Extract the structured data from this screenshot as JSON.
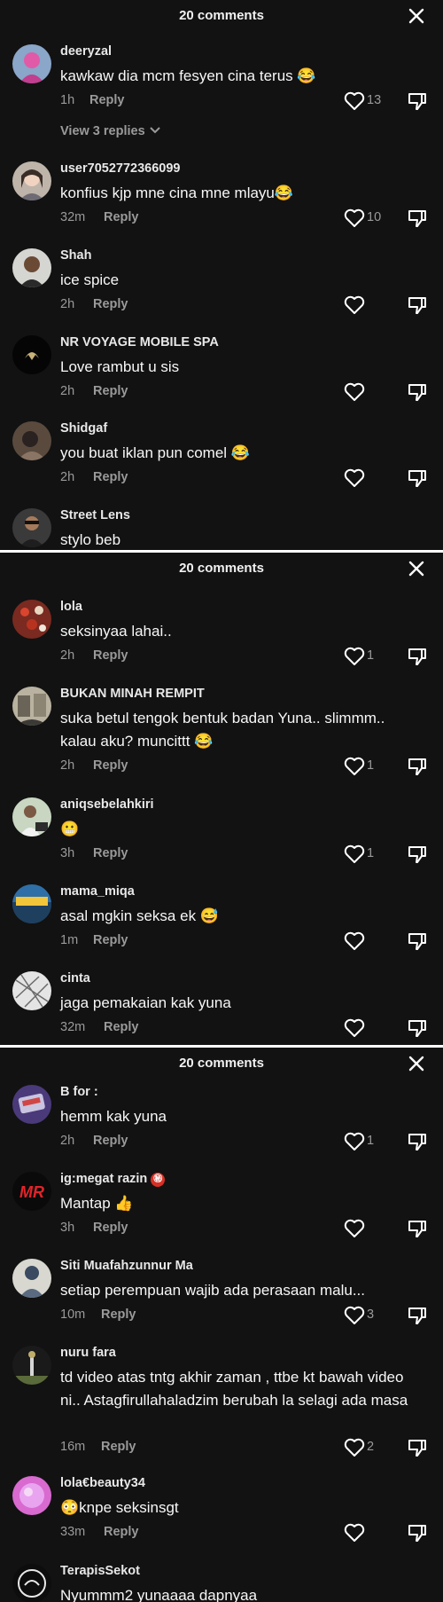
{
  "sheets": [
    {
      "title": "20 comments",
      "comments": [
        {
          "user": "deeryzal",
          "text": "kawkaw dia mcm fesyen cina terus 😂",
          "time": "1h",
          "reply": "Reply",
          "likes": "13",
          "view_replies": "View 3 replies"
        },
        {
          "user": "user7052772366099",
          "text": "konfius kjp mne cina mne mlayu😂",
          "time": "32m",
          "reply": "Reply",
          "likes": "10"
        },
        {
          "user": "Shah",
          "text": "ice spice",
          "time": "2h",
          "reply": "Reply",
          "likes": ""
        },
        {
          "user": "NR VOYAGE MOBILE SPA",
          "text": "Love rambut u sis",
          "time": "2h",
          "reply": "Reply",
          "likes": ""
        },
        {
          "user": "Shidgaf",
          "text": "you buat iklan pun comel 😂",
          "time": "2h",
          "reply": "Reply",
          "likes": ""
        },
        {
          "user": "Street Lens",
          "text": "stylo beb",
          "time": "",
          "reply": "",
          "likes": ""
        }
      ]
    },
    {
      "title": "20 comments",
      "comments": [
        {
          "user": "lola",
          "text": "seksinyaa lahai..",
          "time": "2h",
          "reply": "Reply",
          "likes": "1"
        },
        {
          "user": "BUKAN MINAH REMPIT",
          "text": "suka betul tengok bentuk badan Yuna.. slimmm.. kalau aku? muncittt 😂",
          "time": "2h",
          "reply": "Reply",
          "likes": "1"
        },
        {
          "user": "aniqsebelahkiri",
          "text": "😬",
          "time": "3h",
          "reply": "Reply",
          "likes": "1"
        },
        {
          "user": "mama_miqa",
          "text": "asal mgkin seksa ek 😅",
          "time": "1m",
          "reply": "Reply",
          "likes": ""
        },
        {
          "user": "cinta",
          "text": "jaga pemakaian kak yuna",
          "time": "32m",
          "reply": "Reply",
          "likes": ""
        }
      ]
    },
    {
      "title": "20 comments",
      "comments": [
        {
          "user": "B for :",
          "text": "hemm kak yuna",
          "time": "2h",
          "reply": "Reply",
          "likes": "1"
        },
        {
          "user": "ig:megat razin",
          "badge": "㊙",
          "text": "Mantap 👍",
          "time": "3h",
          "reply": "Reply",
          "likes": ""
        },
        {
          "user": "Siti Muafahzunnur Ma",
          "text": "setiap perempuan wajib ada perasaan malu...",
          "time": "10m",
          "reply": "Reply",
          "likes": "3"
        },
        {
          "user": "nuru fara",
          "text": "td video atas tntg akhir zaman , ttbe kt bawah video ni.. Astagfirullahaladzim berubah la selagi ada masa",
          "time": "16m",
          "reply": "Reply",
          "likes": "2"
        },
        {
          "user": "lola€beauty34",
          "text": "😳knpe seksinsgt",
          "time": "33m",
          "reply": "Reply",
          "likes": ""
        },
        {
          "user": "TerapisSekot",
          "text": "Nyummm2 yunaaaa dapnyaa",
          "time": "",
          "reply": "",
          "likes": ""
        }
      ]
    }
  ],
  "colors": {
    "background": "#121212",
    "text": "#ffffff",
    "muted": "#9a9a9a"
  },
  "icons": {
    "close": "close-icon",
    "like": "heart-outline-icon",
    "dislike": "thumbs-down-icon",
    "chevron": "chevron-down-icon"
  }
}
